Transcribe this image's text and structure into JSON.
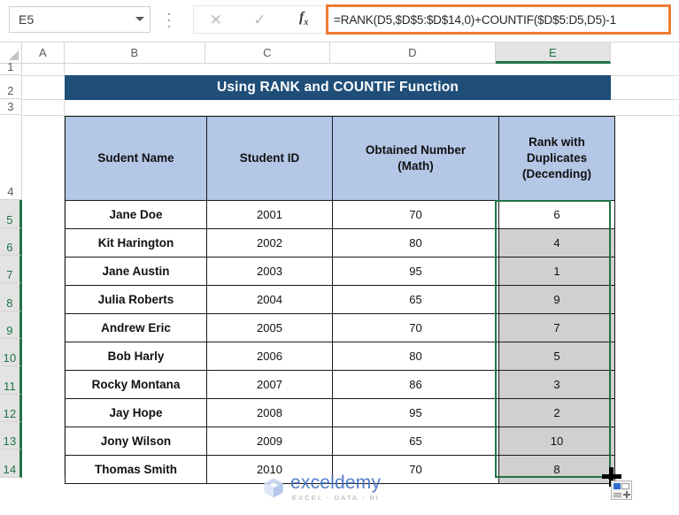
{
  "formula_bar": {
    "name_box_value": "E5",
    "name_box_placeholder": "Name Box",
    "cancel_icon": "close-icon",
    "confirm_icon": "check-icon",
    "function_icon": "fx",
    "formula_value": "=RANK(D5,$D$5:$D$14,0)+COUNTIF($D$5:D5,D5)-1",
    "formula_placeholder": "Enter formula",
    "highlight_color": "#ED7D31"
  },
  "grid": {
    "column_headers": [
      "A",
      "B",
      "C",
      "D",
      "E"
    ],
    "selected_column": "E",
    "row_headers": [
      "1",
      "2",
      "3",
      "4",
      "5",
      "6",
      "7",
      "8",
      "9",
      "10",
      "11",
      "12",
      "13",
      "14"
    ],
    "selected_rows": [
      "5",
      "6",
      "7",
      "8",
      "9",
      "10",
      "11",
      "12",
      "13",
      "14"
    ],
    "selection_color": "#217346",
    "active_cell": "E5",
    "selected_range": "E5:E14"
  },
  "sheet": {
    "title_banner": "Using RANK and COUNTIF Function",
    "title_banner_bg": "#1F4E79",
    "header_bg": "#B4C7E7",
    "selected_cell_bg": "#D0D0D0"
  },
  "table": {
    "headers": [
      "Sudent Name",
      "Student ID",
      "Obtained Number (Math)",
      "Rank with Duplicates (Decending)"
    ],
    "header_lines": [
      [
        "Sudent Name"
      ],
      [
        "Student ID"
      ],
      [
        "Obtained Number",
        "(Math)"
      ],
      [
        "Rank with",
        "Duplicates",
        "(Decending)"
      ]
    ],
    "rows": [
      {
        "row": "5",
        "name": "Jane Doe",
        "id": "2001",
        "marks": "70",
        "rank": "6",
        "rank_selected": false
      },
      {
        "row": "6",
        "name": "Kit Harington",
        "id": "2002",
        "marks": "80",
        "rank": "4",
        "rank_selected": true
      },
      {
        "row": "7",
        "name": "Jane Austin",
        "id": "2003",
        "marks": "95",
        "rank": "1",
        "rank_selected": true
      },
      {
        "row": "8",
        "name": "Julia Roberts",
        "id": "2004",
        "marks": "65",
        "rank": "9",
        "rank_selected": true
      },
      {
        "row": "9",
        "name": "Andrew Eric",
        "id": "2005",
        "marks": "70",
        "rank": "7",
        "rank_selected": true
      },
      {
        "row": "10",
        "name": "Bob Harly",
        "id": "2006",
        "marks": "80",
        "rank": "5",
        "rank_selected": true
      },
      {
        "row": "11",
        "name": "Rocky Montana",
        "id": "2007",
        "marks": "86",
        "rank": "3",
        "rank_selected": true
      },
      {
        "row": "12",
        "name": "Jay Hope",
        "id": "2008",
        "marks": "95",
        "rank": "2",
        "rank_selected": true
      },
      {
        "row": "13",
        "name": "Jony Wilson",
        "id": "2009",
        "marks": "65",
        "rank": "10",
        "rank_selected": true
      },
      {
        "row": "14",
        "name": "Thomas Smith",
        "id": "2010",
        "marks": "70",
        "rank": "8",
        "rank_selected": true
      }
    ]
  },
  "cursor": {
    "type": "fill-handle-crosshair",
    "badge_icon": "paste-options-icon"
  },
  "watermark": {
    "brand": "exceldemy",
    "tagline": "EXCEL - DATA - BI",
    "brand_color": "#4472C4"
  }
}
